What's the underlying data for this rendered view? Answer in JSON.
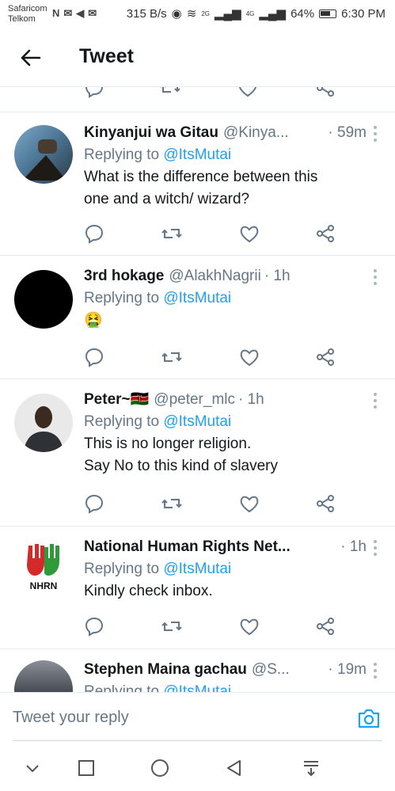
{
  "status_bar": {
    "carrier_1": "Safaricom",
    "carrier_2": "Telkom",
    "speed": "315 B/s",
    "net_2g": "2G",
    "net_4g": "4G",
    "battery": "64%",
    "time": "6:30 PM"
  },
  "header": {
    "title": "Tweet"
  },
  "tweets": [
    {
      "name": "Kinyanjui wa Gitau",
      "handle": "@Kinya...",
      "time": "· 59m",
      "replying_prefix": "Replying to ",
      "replying_to": "@ItsMutai",
      "body_1": "What is the difference between this",
      "body_2": "one and a witch/ wizard?"
    },
    {
      "name": "3rd hokage",
      "handle": "@AlakhNagrii",
      "time": "· 1h",
      "replying_prefix": "Replying to ",
      "replying_to": "@ItsMutai",
      "body_1": "🤮"
    },
    {
      "name": "Peter~🇰🇪",
      "handle": "@peter_mlc",
      "time": "· 1h",
      "replying_prefix": "Replying to ",
      "replying_to": "@ItsMutai",
      "body_1": "This is no longer religion.",
      "body_2": "Say No to this kind of slavery"
    },
    {
      "name": "National Human Rights Net...",
      "handle": "",
      "time": "· 1h",
      "replying_prefix": "Replying to ",
      "replying_to": "@ItsMutai",
      "body_1": "Kindly check inbox.",
      "avatar_text": "NHRN"
    },
    {
      "name": "Stephen Maina gachau",
      "handle": "@S...",
      "time": "· 19m",
      "replying_prefix": "Replying to ",
      "replying_to": "@ItsMutai"
    }
  ],
  "reply_bar": {
    "placeholder": "Tweet your reply"
  },
  "colors": {
    "accent": "#1da1f2",
    "muted": "#657786",
    "icon": "#657786",
    "divider": "#e6ecf0"
  }
}
